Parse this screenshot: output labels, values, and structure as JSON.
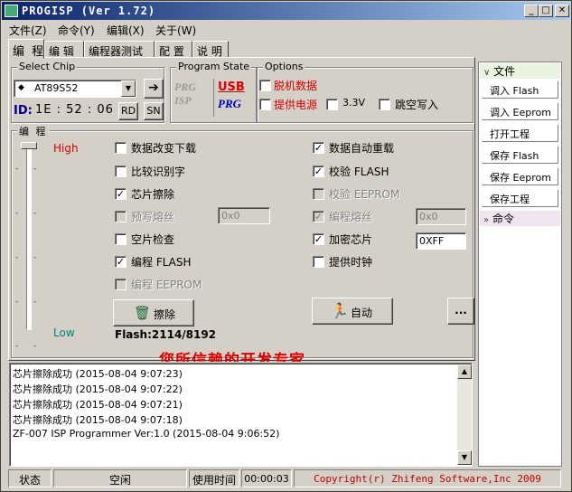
{
  "window": {
    "title": "PROGISP (Ver 1.72)"
  },
  "menu": {
    "items": [
      "文件(Z)",
      "命令(Y)",
      "编辑(X)",
      "关于(W)"
    ]
  },
  "tabs": [
    "编 程",
    "编 辑",
    "编程器测试",
    "配 置",
    "说 明"
  ],
  "select_chip": {
    "label": "Select Chip",
    "chip": "AT89S52",
    "id_label": "ID:",
    "id_value": "1E : 52 : 06",
    "rd": "RD",
    "sn": "SN"
  },
  "program_state": {
    "label": "Program State",
    "prg_isp": "PRG ISP",
    "usb": "USB",
    "usb_prg": "PRG"
  },
  "options": {
    "label": "Options",
    "items": [
      {
        "label": "脱机数据",
        "checked": false
      },
      {
        "label": "提供电源",
        "checked": false
      },
      {
        "label": "3.3V",
        "checked": false
      },
      {
        "label": "跳空写入",
        "checked": false
      }
    ]
  },
  "program": {
    "label": "编 程",
    "slider": {
      "high": "High",
      "low": "Low",
      "level": 1.0
    },
    "left_options": [
      {
        "label": "数据改变下载",
        "checked": false,
        "enabled": true
      },
      {
        "label": "比较识别字",
        "checked": false,
        "enabled": true
      },
      {
        "label": "芯片擦除",
        "checked": true,
        "enabled": true
      },
      {
        "label": "预写熔丝",
        "checked": false,
        "enabled": false
      },
      {
        "label": "空片检查",
        "checked": false,
        "enabled": true
      },
      {
        "label": "编程 FLASH",
        "checked": true,
        "enabled": true
      },
      {
        "label": "编程 EEPROM",
        "checked": false,
        "enabled": false
      }
    ],
    "right_options": [
      {
        "label": "数据自动重载",
        "checked": true,
        "enabled": true
      },
      {
        "label": "校验 FLASH",
        "checked": true,
        "enabled": true
      },
      {
        "label": "校验 EEPROM",
        "checked": false,
        "enabled": false
      },
      {
        "label": "编程熔丝",
        "checked": true,
        "enabled": false
      },
      {
        "label": "加密芯片",
        "checked": true,
        "enabled": true
      },
      {
        "label": "提供时钟",
        "checked": false,
        "enabled": true
      }
    ],
    "prewrite_fuse_value": "0x0",
    "program_fuse_value": "0x0",
    "encrypt_value": "0XFF",
    "erase_button": "擦除",
    "auto_button": "自动",
    "more_button": "...",
    "flash_info": "Flash:2114/8192",
    "banner": "您所信赖的开发专家"
  },
  "log": [
    "芯片擦除成功 (2015-08-04 9:07:23)",
    "芯片擦除成功 (2015-08-04 9:07:22)",
    "芯片擦除成功 (2015-08-04 9:07:21)",
    "芯片擦除成功 (2015-08-04 9:07:18)",
    "ZF-007 ISP Programmer Ver:1.0 (2015-08-04 9:06:52)"
  ],
  "sidebar": {
    "file_header": "文件",
    "buttons": [
      "调入 Flash",
      "调入 Eeprom",
      "打开工程",
      "保存 Flash",
      "保存 Eeprom",
      "保存工程"
    ],
    "command_header": "命令"
  },
  "status": {
    "state_label": "状态",
    "state_value": "空闲",
    "time_label": "使用时间",
    "time_value": "00:00:03",
    "copyright": "Copyright(r) Zhifeng Software,Inc 2009"
  },
  "colors": {
    "title_start": "#0a246a",
    "title_end": "#a6caf0",
    "warn_red": "#d40000",
    "copyright_red": "#c00000",
    "banner_red": "#e00000"
  }
}
